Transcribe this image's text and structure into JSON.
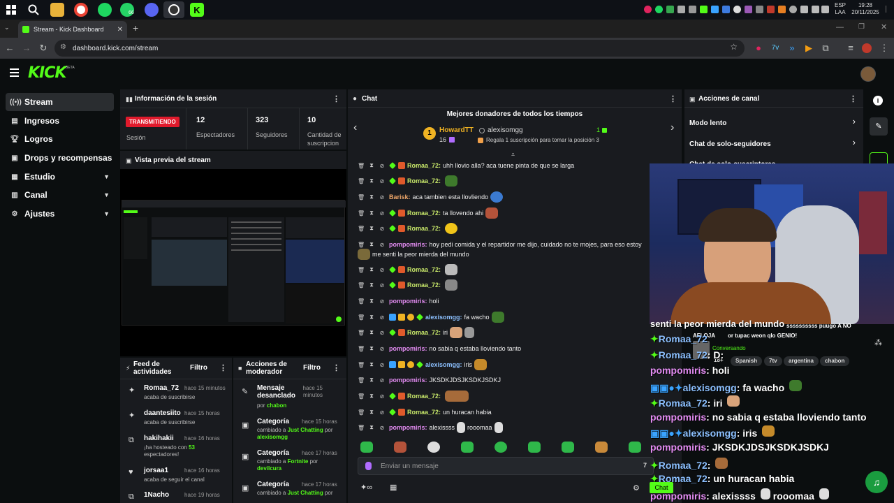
{
  "taskbar": {
    "lang": "ESP",
    "lang2": "LAA",
    "time": "19:28",
    "date": "20/11/2025",
    "whatsapp_count": "66"
  },
  "browser": {
    "tab_title": "Stream - Kick Dashboard",
    "url": "dashboard.kick.com/stream"
  },
  "kick": {
    "logo": "KICK",
    "logo_badge": "BETA"
  },
  "sidebar": {
    "items": [
      {
        "label": "Stream",
        "icon": "broadcast-icon"
      },
      {
        "label": "Ingresos",
        "icon": "ledger-icon"
      },
      {
        "label": "Logros",
        "icon": "trophy-icon"
      },
      {
        "label": "Drops y recompensas",
        "icon": "gift-icon"
      },
      {
        "label": "Estudio",
        "icon": "studio-icon"
      },
      {
        "label": "Canal",
        "icon": "channel-icon"
      },
      {
        "label": "Ajustes",
        "icon": "gear-icon"
      }
    ]
  },
  "session": {
    "title": "Información de la sesión",
    "badge": "TRANSMITIENDO",
    "session_label": "Sesión",
    "viewers": "12",
    "viewers_label": "Espectadores",
    "followers": "323",
    "followers_label": "Seguidores",
    "subs": "10",
    "subs_label_1": "Cantidad de",
    "subs_label_2": "suscripcion"
  },
  "preview": {
    "title": "Vista previa del stream"
  },
  "activity": {
    "title_1": "Feed de",
    "title_2": "actividades",
    "filter": "Filtro",
    "items": [
      {
        "name": "Romaa_72",
        "time": "hace 15 minutos",
        "desc": "acaba de suscribirse"
      },
      {
        "name": "daantesiito",
        "time": "hace 15 horas",
        "desc": "acaba de suscribirse"
      },
      {
        "name": "hakihakii",
        "time": "hace 16 horas",
        "desc_pre": "¡ha hosteado con",
        "desc_num": "53",
        "desc_post": "espectadores!"
      },
      {
        "name": "jorsaa1",
        "time": "hace 16 horas",
        "desc": "acaba de seguir el canal"
      },
      {
        "name": "1Nacho",
        "time": "hace 19 horas",
        "desc": ""
      }
    ]
  },
  "modactions": {
    "title_1": "Acciones de",
    "title_2": "moderador",
    "filter": "Filtro",
    "items": [
      {
        "name": "Mensaje desanclado",
        "time": "hace 15 minutos",
        "desc_pre": "por",
        "desc_user": "chabon"
      },
      {
        "name": "Categoría",
        "time": "hace 15 horas",
        "desc_pre": "cambiado a",
        "desc_cat": "Just Chatting",
        "desc_mid": "por",
        "desc_user": "alexisomgg"
      },
      {
        "name": "Categoría",
        "time": "hace 17 horas",
        "desc_pre": "cambiado a",
        "desc_cat": "Fortnite",
        "desc_mid": "por",
        "desc_user": "devilcura"
      },
      {
        "name": "Categoría",
        "time": "hace 17 horas",
        "desc_pre": "cambiado a",
        "desc_cat": "Just Chatting",
        "desc_mid": "por",
        "desc_user": ""
      }
    ]
  },
  "chat": {
    "title": "Chat",
    "donors_title": "Mejores donadores de todos los tiempos",
    "top_donor": "HowardTT",
    "top_donor_amount": "16",
    "second_donor": "alexisomgg",
    "second_amount": "1",
    "gift_prompt": "Regala 1 suscripción para tomar la posición 3",
    "input_placeholder": "Enviar un mensaje",
    "messages": [
      {
        "user": "Romaa_72",
        "color": "#c8e86a",
        "text": "uhh llovio alla? aca tuene pinta de que se larga"
      },
      {
        "user": "Romaa_72",
        "color": "#c8e86a",
        "text": ""
      },
      {
        "user": "Barisk",
        "color": "#f0a86a",
        "text": "aca tambien esta llovliendo"
      },
      {
        "user": "Romaa_72",
        "color": "#c8e86a",
        "text": "ta llovendo ahi"
      },
      {
        "user": "Romaa_72",
        "color": "#c8e86a",
        "text": ""
      },
      {
        "user": "pompomiris",
        "color": "#e38cf2",
        "text": "hoy pedi comida y el repartidor me dijo, cuidado no te mojes, para eso estoy",
        "cont": "me senti la peor mierda del mundo"
      },
      {
        "user": "Romaa_72",
        "color": "#c8e86a",
        "text": ""
      },
      {
        "user": "Romaa_72",
        "color": "#c8e86a",
        "text": ""
      },
      {
        "user": "pompomiris",
        "color": "#e38cf2",
        "text": "holi"
      },
      {
        "user": "alexisomgg",
        "color": "#8cc0ff",
        "text": "fa wacho"
      },
      {
        "user": "Romaa_72",
        "color": "#c8e86a",
        "text": "iri"
      },
      {
        "user": "pompomiris",
        "color": "#e38cf2",
        "text": "no sabia q estaba lloviendo tanto"
      },
      {
        "user": "alexisomgg",
        "color": "#8cc0ff",
        "text": "iris"
      },
      {
        "user": "pompomiris",
        "color": "#e38cf2",
        "text": "JKSDKJDSJKSDKJSDKJ"
      },
      {
        "user": "Romaa_72",
        "color": "#c8e86a",
        "text": ""
      },
      {
        "user": "Romaa_72",
        "color": "#c8e86a",
        "text": "un huracan habia"
      },
      {
        "user": "pompomiris",
        "color": "#e38cf2",
        "text": "alexissss",
        "tail": "rooomaa"
      }
    ]
  },
  "channel_actions": {
    "title": "Acciones de canal",
    "items": [
      "Modo lento",
      "Chat de solo-seguidores",
      "Chat de solo-suscriptores"
    ]
  },
  "overlay": {
    "top_partial": "senti la peor mierda del mundo",
    "mini_line_1": "ssssssssss puugo A NO",
    "mini_line_2": "AFLOJA",
    "mini_line_3": "or tupac weon qlo GENIO!",
    "status": "Conversando",
    "age": "18+",
    "tags": [
      "Spanish",
      "7tv",
      "argentina",
      "chabon"
    ],
    "lines": [
      {
        "user": "Romaa_72",
        "color": "#8cc0ff",
        "text": ""
      },
      {
        "user": "Romaa_72",
        "color": "#8cc0ff",
        "text": "D:"
      },
      {
        "user": "pompomiris",
        "color": "#e38cf2",
        "text": "holi"
      },
      {
        "user": "alexisomgg",
        "color": "#8cc0ff",
        "text": "fa wacho"
      },
      {
        "user": "Romaa_72",
        "color": "#8cc0ff",
        "text": "iri"
      },
      {
        "user": "pompomiris",
        "color": "#e38cf2",
        "text": "no sabia q estaba lloviendo tanto"
      },
      {
        "user": "alexisomgg",
        "color": "#8cc0ff",
        "text": "iris"
      },
      {
        "user": "pompomiris",
        "color": "#e38cf2",
        "text": "JKSDKJDSJKSDKJSDKJ"
      },
      {
        "user": "Romaa_72",
        "color": "#8cc0ff",
        "text": ""
      },
      {
        "user": "Romaa_72",
        "color": "#8cc0ff",
        "text": "un huracan habia"
      },
      {
        "user": "pompomiris",
        "color": "#e38cf2",
        "text": "alexissss",
        "tail": "rooomaa"
      }
    ],
    "chat_button": "Chat"
  },
  "colors": {
    "brand": "#53fc18",
    "live": "#e01a2c",
    "panel": "#191b1f"
  }
}
